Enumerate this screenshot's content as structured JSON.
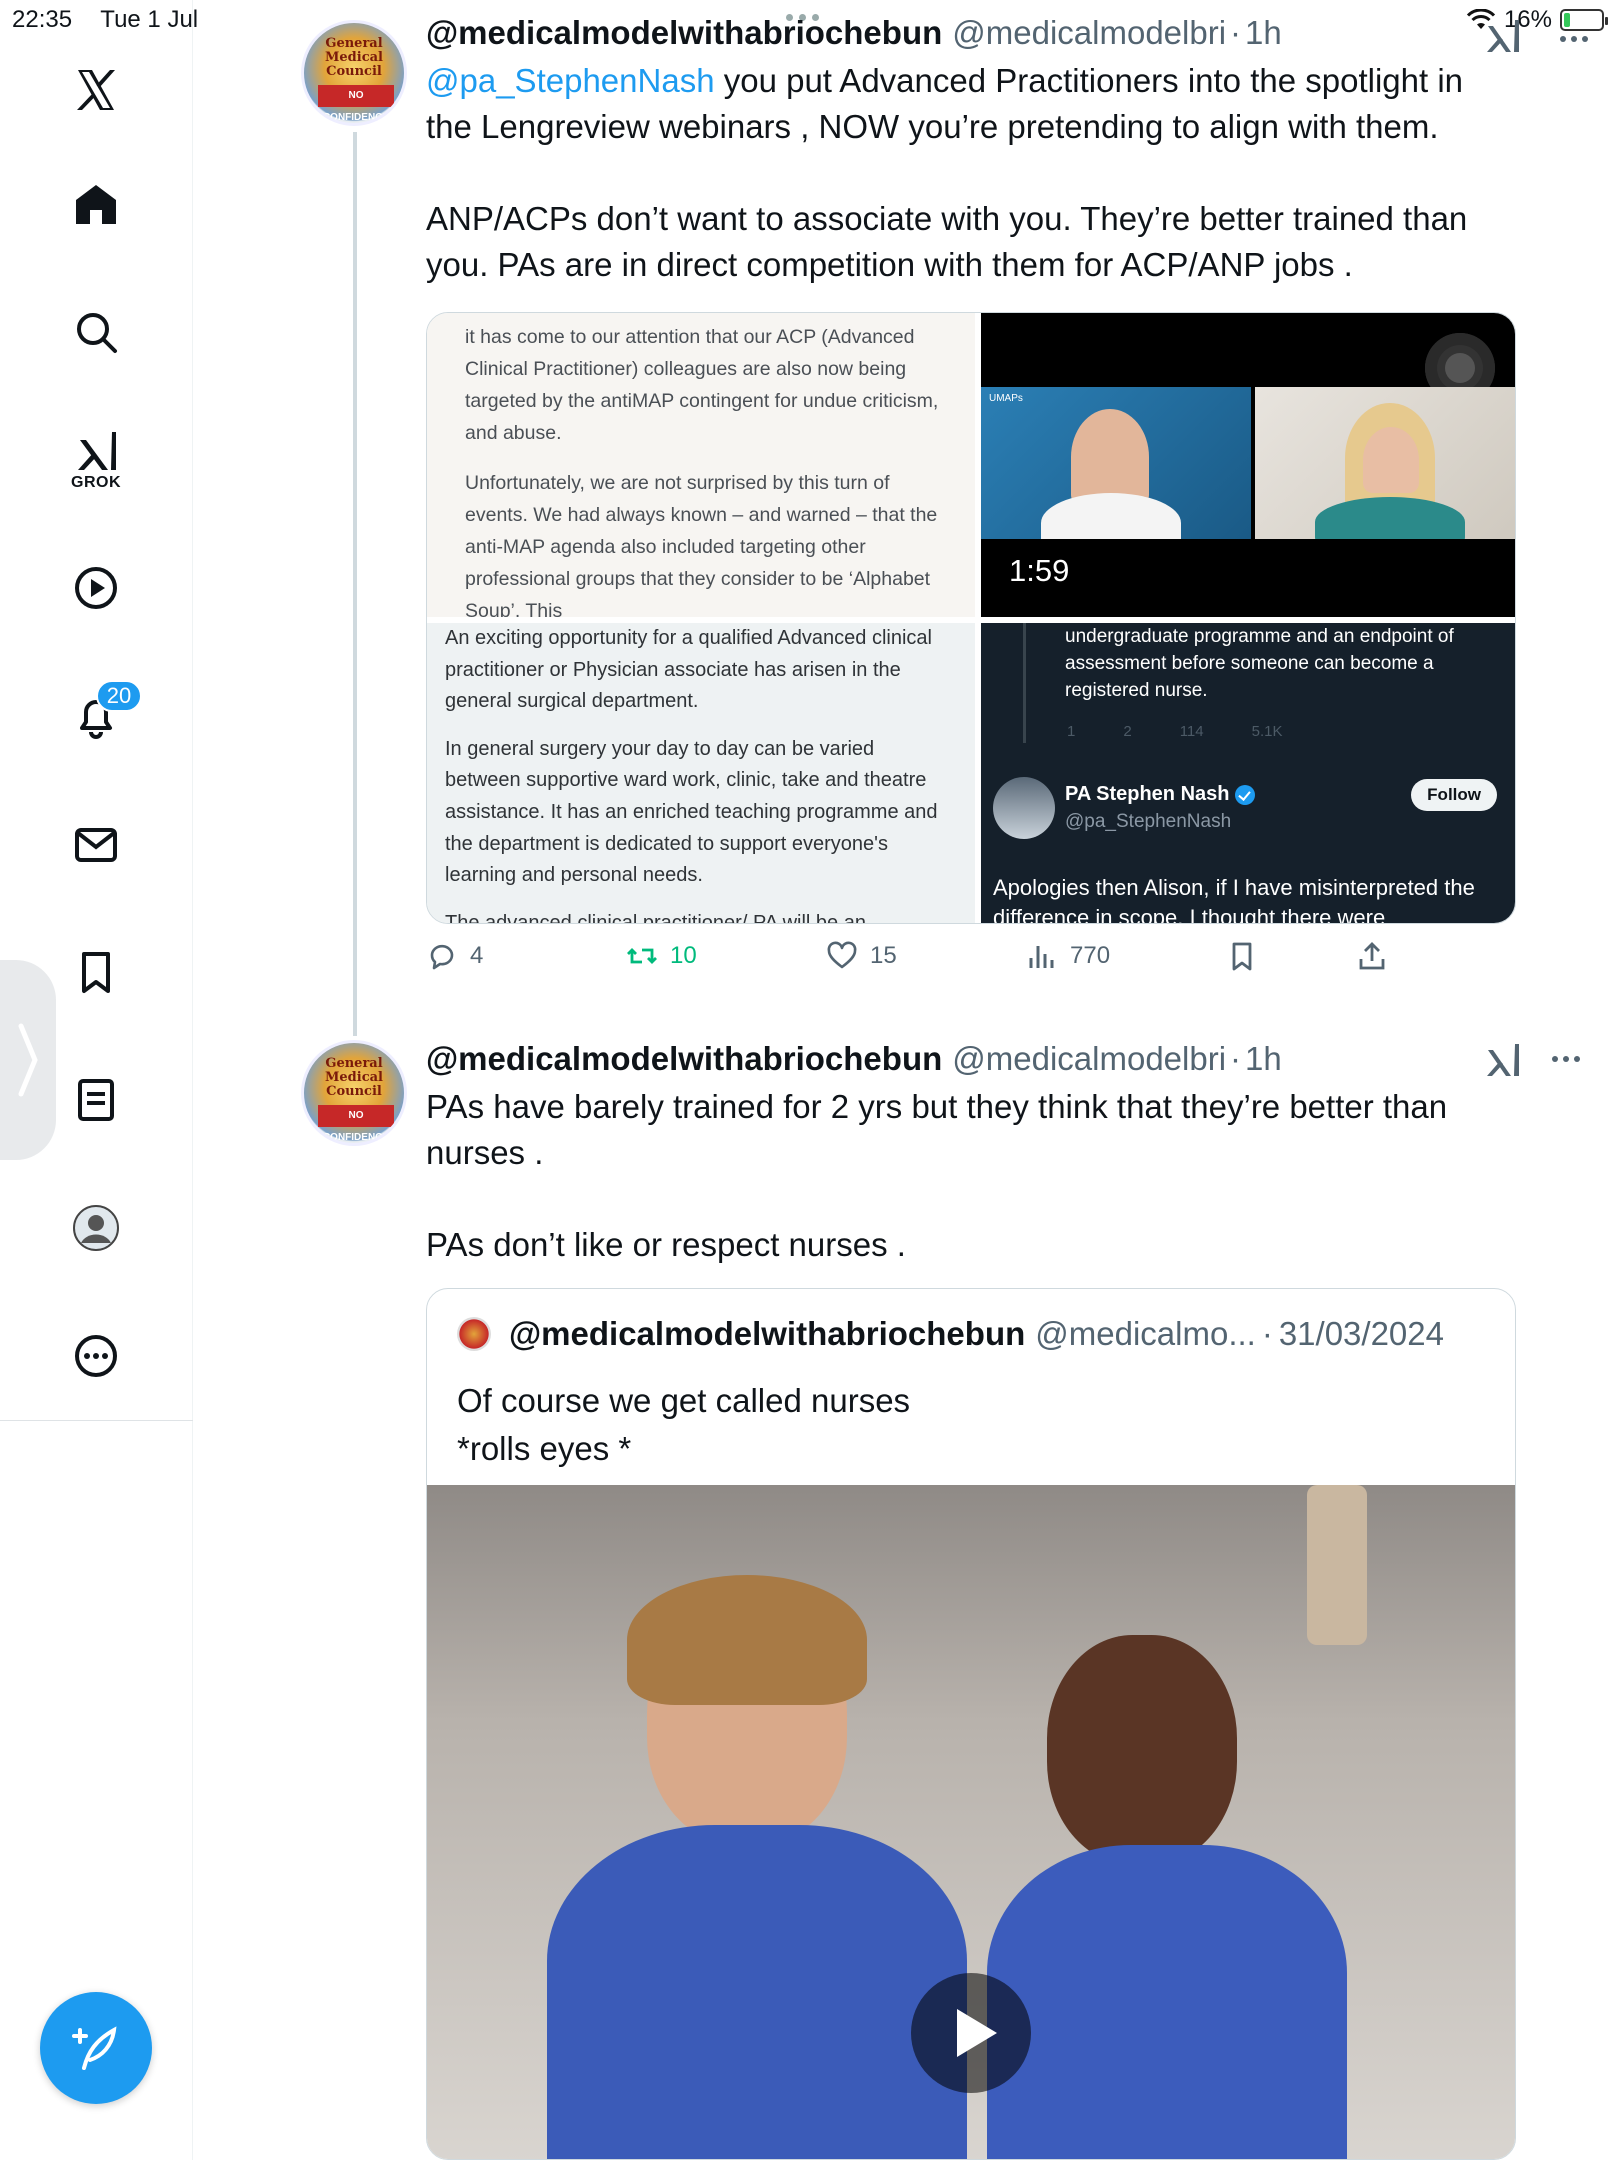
{
  "status_bar": {
    "time": "22:35",
    "date": "Tue 1 Jul",
    "battery_percent": "16%",
    "battery_level": 0.16
  },
  "sidebar": {
    "items": [
      {
        "name": "x-logo"
      },
      {
        "name": "home"
      },
      {
        "name": "explore"
      },
      {
        "name": "grok",
        "label": "GROK"
      },
      {
        "name": "video"
      },
      {
        "name": "notifications",
        "badge": "20"
      },
      {
        "name": "messages"
      },
      {
        "name": "bookmarks"
      },
      {
        "name": "lists"
      },
      {
        "name": "profile"
      },
      {
        "name": "more"
      }
    ]
  },
  "tweets": [
    {
      "name": "@medicalmodelwithabriochebun",
      "handle": "@medicalmodelbri",
      "sep": "·",
      "time": "1h",
      "mention": "@pa_StephenNash",
      "text_after_mention": " you put Advanced Practitioners into the spotlight in the Lengreview webinars , NOW you’re pretending to align with them.",
      "para2": "ANP/ACPs don’t want to associate with you. They’re better trained than you. PAs are in direct competition with them for ACP/ANP jobs .",
      "media": {
        "top_left": [
          "it has come to our attention that our ACP (Advanced Clinical Practitioner) colleagues are also now being targeted by the antiMAP contingent for undue criticism, and abuse.",
          "Unfortunately, we are not surprised by this turn of events. We had always known – and warned – that the anti-MAP agenda also included targeting other professional groups that they consider to be ‘Alphabet Soup’. This"
        ],
        "bottom_left": [
          "An exciting opportunity for a qualified Advanced clinical practitioner or Physician associate has arisen in the general surgical department.",
          "In general surgery your day to day can be varied between supportive ward work, clinic, take and theatre assistance. It has an enriched teaching programme and the department is dedicated to support everyone's learning and personal needs.",
          "The advanced clinical practitioner/ PA will be an"
        ],
        "video_duration": "1:59",
        "video_logo": "UMAPs",
        "bottom_right": {
          "text": "undergraduate programme and an endpoint of assessment before someone can become a registered nurse.",
          "stats": [
            "1",
            "2",
            "114",
            "5.1K"
          ],
          "name": "PA Stephen Nash",
          "handle": "@pa_StephenNash",
          "follow": "Follow",
          "reply": "Apologies then Alison, if I have misinterpreted the difference in scope. I thought there were"
        }
      },
      "actions": {
        "replies": "4",
        "reposts": "10",
        "likes": "15",
        "views": "770"
      }
    },
    {
      "name": "@medicalmodelwithabriochebun",
      "handle": "@medicalmodelbri",
      "sep": "·",
      "time": "1h",
      "para1": "PAs have barely trained for 2 yrs but they think that they’re better than nurses .",
      "para2": "PAs don’t like or respect nurses .",
      "quote": {
        "name": "@medicalmodelwithabriochebun",
        "handle": "@medicalmo...",
        "sep": "·",
        "date": "31/03/2024",
        "line1": "Of course we get called nurses",
        "line2": "*rolls eyes *"
      }
    }
  ],
  "avatar_text": {
    "lines": "General Medical Council",
    "red": "NO CONFIDENCE"
  },
  "colors": {
    "accent": "#1d9bf0",
    "repost_active": "#00ba7c",
    "secondary_text": "#536471"
  }
}
